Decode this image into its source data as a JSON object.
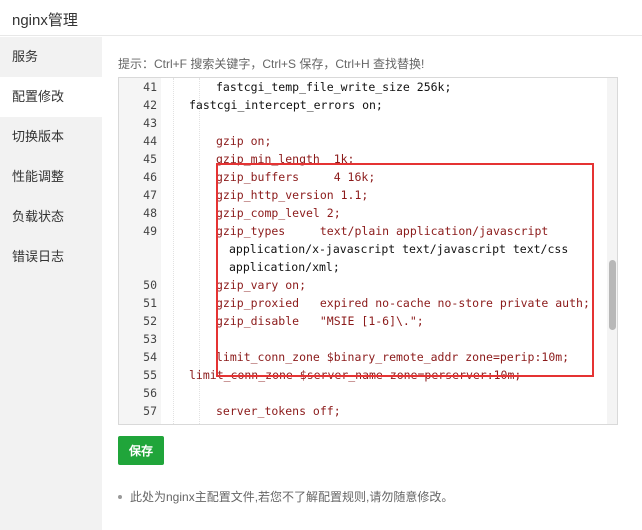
{
  "window": {
    "title": "nginx管理"
  },
  "sidebar": {
    "items": [
      {
        "label": "服务",
        "active": false
      },
      {
        "label": "配置修改",
        "active": true
      },
      {
        "label": "切换版本",
        "active": false
      },
      {
        "label": "性能调整",
        "active": false
      },
      {
        "label": "负载状态",
        "active": false
      },
      {
        "label": "错误日志",
        "active": false
      }
    ]
  },
  "main": {
    "tip": "提示：Ctrl+F 搜索关键字，Ctrl+S 保存，Ctrl+H 查找替换!",
    "save_label": "保存",
    "note": "此处为nginx主配置文件,若您不了解配置规则,请勿随意修改。"
  },
  "editor": {
    "lines": [
      {
        "num": "41",
        "text": "fastcgi_temp_file_write_size 256k;"
      },
      {
        "num": "42",
        "text": "fastcgi_intercept_errors on;"
      },
      {
        "num": "43",
        "text": ""
      },
      {
        "num": "44",
        "text": "gzip on;"
      },
      {
        "num": "45",
        "text": "gzip_min_length  1k;"
      },
      {
        "num": "46",
        "text": "gzip_buffers     4 16k;"
      },
      {
        "num": "47",
        "text": "gzip_http_version 1.1;"
      },
      {
        "num": "48",
        "text": "gzip_comp_level 2;"
      },
      {
        "num": "49",
        "text": "gzip_types     text/plain application/javascript"
      },
      {
        "num": "",
        "text": "application/x-javascript text/javascript text/css"
      },
      {
        "num": "",
        "text": "application/xml;"
      },
      {
        "num": "50",
        "text": "gzip_vary on;"
      },
      {
        "num": "51",
        "text": "gzip_proxied   expired no-cache no-store private auth;"
      },
      {
        "num": "52",
        "text": "gzip_disable   \"MSIE [1-6]\\.\";"
      },
      {
        "num": "53",
        "text": ""
      },
      {
        "num": "54",
        "text": "limit_conn_zone $binary_remote_addr zone=perip:10m;"
      },
      {
        "num": "55",
        "text": "limit_conn_zone $server_name zone=perserver:10m;"
      },
      {
        "num": "56",
        "text": ""
      },
      {
        "num": "57",
        "text": "server_tokens off;"
      }
    ]
  },
  "colors": {
    "accent_green": "#20a53a",
    "highlight_red": "#e53333",
    "keyword": "#8b1a1a",
    "value_blue": "#2255c8"
  }
}
